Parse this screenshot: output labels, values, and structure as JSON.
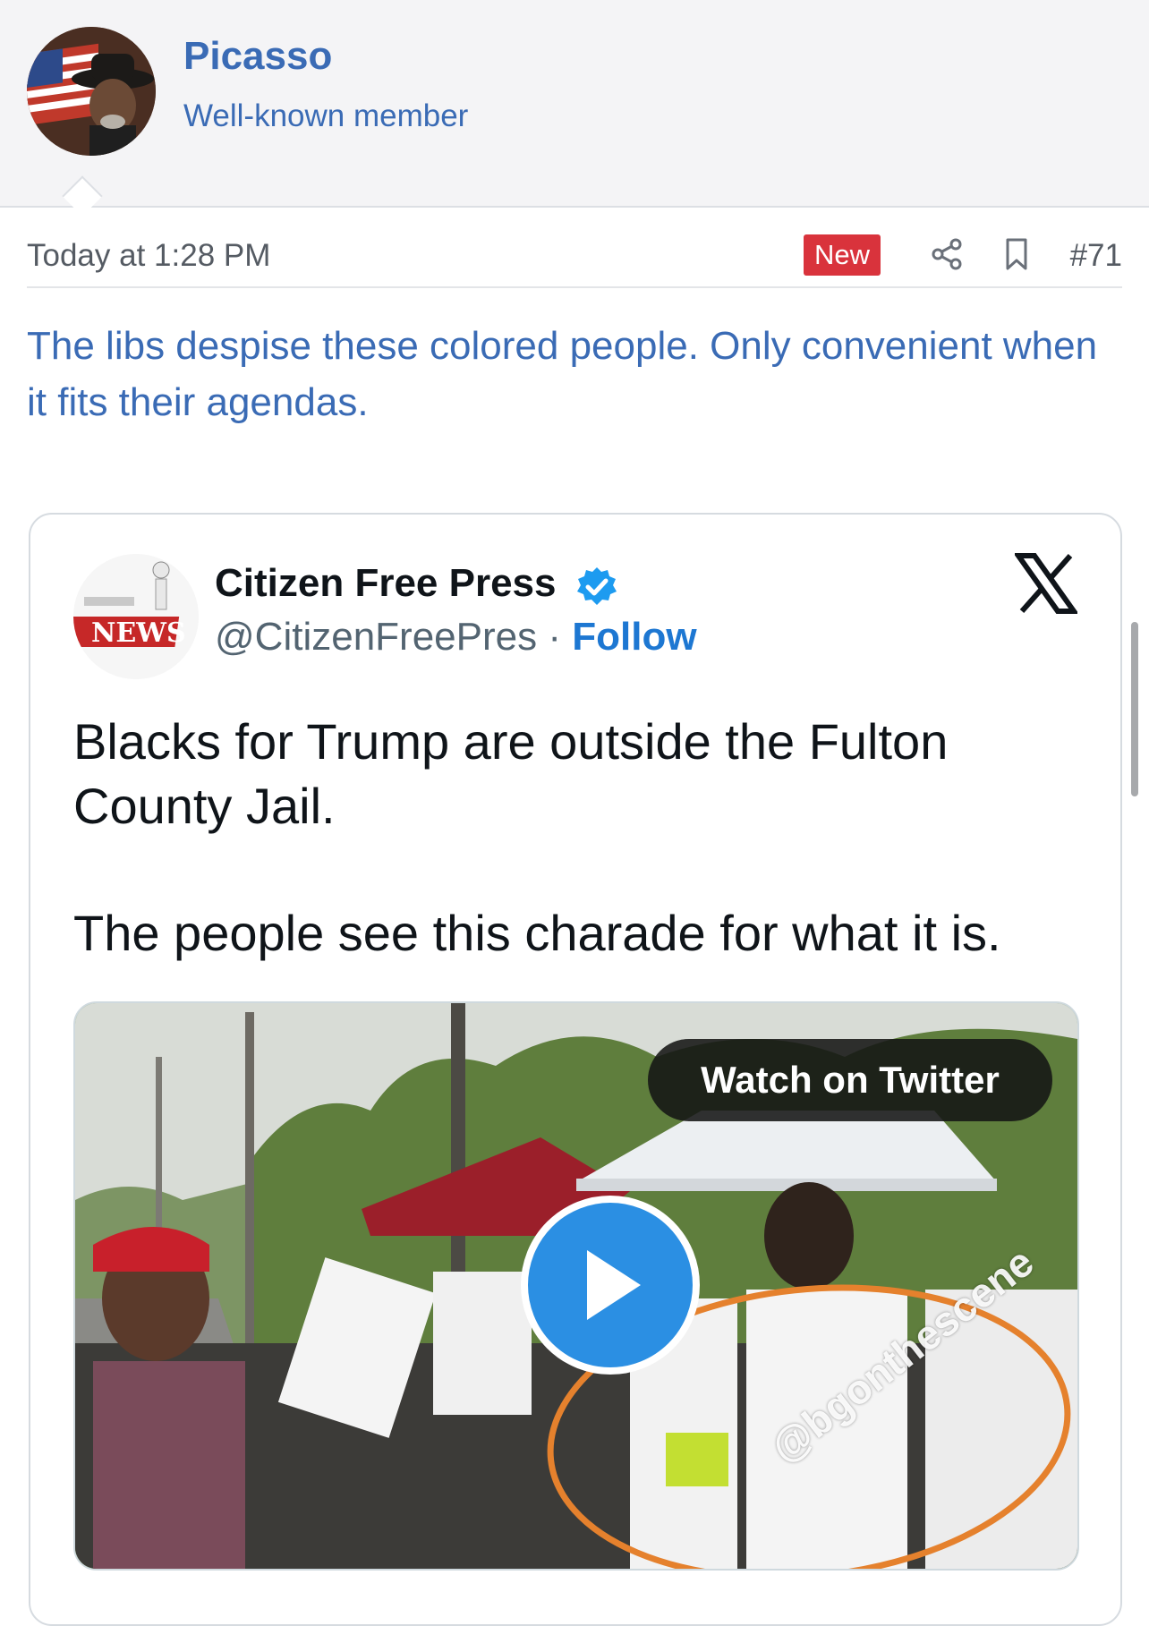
{
  "post": {
    "username": "Picasso",
    "user_title": "Well-known member",
    "timestamp": "Today at 1:28 PM",
    "badge": "New",
    "post_number": "#71",
    "message": "The libs despise these colored people. Only convenient when it fits their agendas.",
    "icons": {
      "share": "share-icon",
      "bookmark": "bookmark-icon"
    }
  },
  "tweet": {
    "display_name": "Citizen Free Press",
    "handle": "@CitizenFreePres",
    "separator": "·",
    "follow_label": "Follow",
    "paragraphs": [
      "Blacks for Trump are outside the Fulton County Jail.",
      "The people see this charade for what it is."
    ],
    "watch_label": "Watch on Twitter",
    "watermark": "@bgonthescene",
    "colors": {
      "accent": "#1d77d2",
      "play_button": "#2b8fe3",
      "verified": "#1d9bf0"
    }
  },
  "colors": {
    "link": "#3a6bb5",
    "badge": "#d9333c",
    "header_bg": "#f4f4f6"
  }
}
